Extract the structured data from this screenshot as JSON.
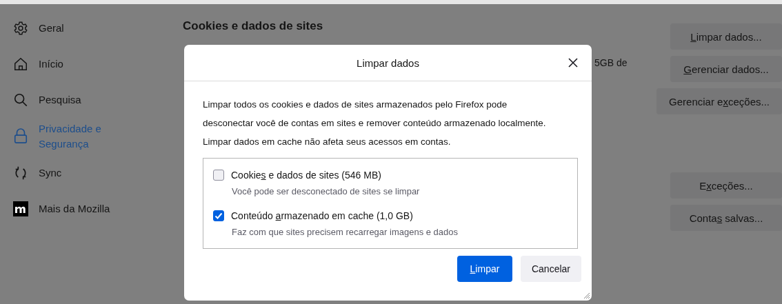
{
  "sidebar": {
    "items": [
      {
        "label": "Geral",
        "kind": "gear",
        "selected": false
      },
      {
        "label": "Início",
        "kind": "home",
        "selected": false
      },
      {
        "label": "Pesquisa",
        "kind": "search",
        "selected": false
      },
      {
        "label": "Privacidade e Segurança",
        "kind": "lock",
        "selected": true
      },
      {
        "label": "Sync",
        "kind": "sync",
        "selected": false
      },
      {
        "label": "Mais da Mozilla",
        "kind": "mozilla",
        "selected": false
      }
    ]
  },
  "section": {
    "heading": "Cookies e dados de sites",
    "partial_text": "5GB de"
  },
  "side_buttons": [
    {
      "label_parts": {
        "key": "L",
        "post": "impar dados..."
      }
    },
    {
      "label_parts": {
        "key": "G",
        "post": "erenciar dados..."
      }
    },
    {
      "label_parts": {
        "pre": "Gerenciar e",
        "key": "x",
        "post": "ceções..."
      }
    }
  ],
  "side_buttons_lower": [
    {
      "label_parts": {
        "pre": "E",
        "key": "x",
        "post": "ceções..."
      }
    },
    {
      "label_parts": {
        "pre": "Conta",
        "key": "s",
        "post": " salvas..."
      }
    }
  ],
  "dialog": {
    "title": "Limpar dados",
    "description": "Limpar todos os cookies e dados de sites armazenados pelo Firefox pode desconectar você de contas em sites e remover conteúdo armazenado localmente. Limpar dados em cache não afeta seus acessos em contas.",
    "options": [
      {
        "label_parts": {
          "pre": "Cookie",
          "key": "s",
          "post": " e dados de sites (546 MB)"
        },
        "hint": "Você pode ser desconectado de sites se limpar",
        "checked": false
      },
      {
        "label_parts": {
          "pre": "Conteúdo ",
          "key": "a",
          "post": "rmazenado em cache (1,0 GB)"
        },
        "hint": "Faz com que sites precisem recarregar imagens e dados",
        "checked": true
      }
    ],
    "buttons": [
      {
        "label_parts": {
          "key": "L",
          "post": "impar"
        },
        "kind": "primary"
      },
      {
        "label_parts": {
          "pre": "Cancelar"
        },
        "kind": "secondary"
      }
    ]
  }
}
